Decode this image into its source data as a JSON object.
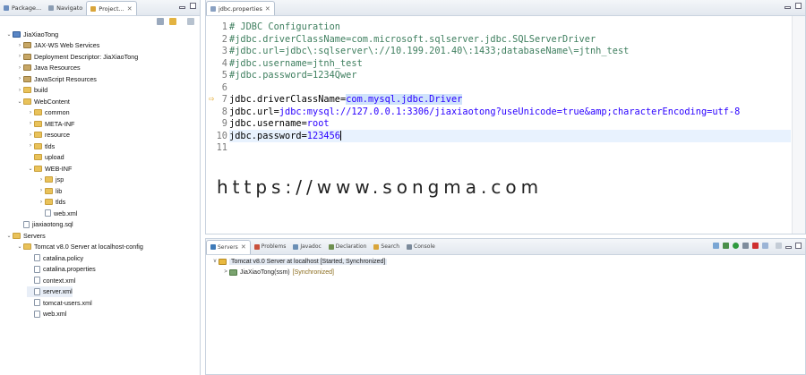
{
  "explorer": {
    "tabs": [
      {
        "label": "Package...",
        "active": false
      },
      {
        "label": "Navigato",
        "active": false
      },
      {
        "label": "Project...",
        "active": true
      }
    ],
    "tree": [
      {
        "label": "JiaXiaoTong",
        "depth": 0,
        "toggle": "v",
        "icon": "proj"
      },
      {
        "label": "JAX-WS Web Services",
        "depth": 1,
        "toggle": ">",
        "icon": "lib"
      },
      {
        "label": "Deployment Descriptor: JiaXiaoTong",
        "depth": 1,
        "toggle": ">",
        "icon": "lib"
      },
      {
        "label": "Java Resources",
        "depth": 1,
        "toggle": ">",
        "icon": "lib"
      },
      {
        "label": "JavaScript Resources",
        "depth": 1,
        "toggle": ">",
        "icon": "lib"
      },
      {
        "label": "build",
        "depth": 1,
        "toggle": ">",
        "icon": "folder"
      },
      {
        "label": "WebContent",
        "depth": 1,
        "toggle": "v",
        "icon": "folder"
      },
      {
        "label": "common",
        "depth": 2,
        "toggle": ">",
        "icon": "folder"
      },
      {
        "label": "META-INF",
        "depth": 2,
        "toggle": ">",
        "icon": "folder"
      },
      {
        "label": "resource",
        "depth": 2,
        "toggle": ">",
        "icon": "folder"
      },
      {
        "label": "tlds",
        "depth": 2,
        "toggle": ">",
        "icon": "folder"
      },
      {
        "label": "upload",
        "depth": 2,
        "toggle": "",
        "icon": "folder"
      },
      {
        "label": "WEB-INF",
        "depth": 2,
        "toggle": "v",
        "icon": "folder"
      },
      {
        "label": "jsp",
        "depth": 3,
        "toggle": ">",
        "icon": "folder"
      },
      {
        "label": "lib",
        "depth": 3,
        "toggle": ">",
        "icon": "folder"
      },
      {
        "label": "tlds",
        "depth": 3,
        "toggle": ">",
        "icon": "folder"
      },
      {
        "label": "web.xml",
        "depth": 3,
        "toggle": "",
        "icon": "file"
      },
      {
        "label": "jiaxiaotong.sql",
        "depth": 1,
        "toggle": "",
        "icon": "file"
      },
      {
        "label": "Servers",
        "depth": 0,
        "toggle": "v",
        "icon": "folder"
      },
      {
        "label": "Tomcat v8.0 Server at localhost-config",
        "depth": 1,
        "toggle": "v",
        "icon": "folder"
      },
      {
        "label": "catalina.policy",
        "depth": 2,
        "toggle": "",
        "icon": "file"
      },
      {
        "label": "catalina.properties",
        "depth": 2,
        "toggle": "",
        "icon": "file"
      },
      {
        "label": "context.xml",
        "depth": 2,
        "toggle": "",
        "icon": "file"
      },
      {
        "label": "server.xml",
        "depth": 2,
        "toggle": "",
        "icon": "file",
        "selected": true
      },
      {
        "label": "tomcat-users.xml",
        "depth": 2,
        "toggle": "",
        "icon": "file"
      },
      {
        "label": "web.xml",
        "depth": 2,
        "toggle": "",
        "icon": "file"
      }
    ]
  },
  "editor": {
    "tab": "jdbc.properties",
    "lines": [
      {
        "n": "1",
        "parts": [
          {
            "t": "# JDBC Configuration",
            "c": "cmt"
          }
        ]
      },
      {
        "n": "2",
        "parts": [
          {
            "t": "#jdbc.driverClassName=com.microsoft.sqlserver.jdbc.SQLServerDriver",
            "c": "cmt"
          }
        ]
      },
      {
        "n": "3",
        "parts": [
          {
            "t": "#jdbc.url=jdbc\\:sqlserver\\://10.199.201.40\\:1433;databaseName\\=jtnh_test",
            "c": "cmt"
          }
        ]
      },
      {
        "n": "4",
        "parts": [
          {
            "t": "#jdbc.username=jtnh_test",
            "c": "cmt"
          }
        ]
      },
      {
        "n": "5",
        "parts": [
          {
            "t": "#jdbc.password=1234Qwer",
            "c": "cmt"
          }
        ]
      },
      {
        "n": "6",
        "parts": []
      },
      {
        "n": "7",
        "parts": [
          {
            "t": "jdbc.driverClassName=",
            "c": "key"
          },
          {
            "t": "com.mysql.jdbc.Driver",
            "c": "val sel"
          }
        ]
      },
      {
        "n": "8",
        "parts": [
          {
            "t": "jdbc.url=",
            "c": "key"
          },
          {
            "t": "jdbc:mysql://127.0.0.1:3306/jiaxiaotong?useUnicode=true&amp;characterEncoding=utf-8",
            "c": "val"
          }
        ]
      },
      {
        "n": "9",
        "parts": [
          {
            "t": "jdbc.username=",
            "c": "key"
          },
          {
            "t": "root",
            "c": "val"
          }
        ]
      },
      {
        "n": "10",
        "parts": [
          {
            "t": "jdbc.password=",
            "c": "key"
          },
          {
            "t": "123456",
            "c": "val"
          }
        ],
        "cursor": true
      },
      {
        "n": "11",
        "parts": []
      }
    ]
  },
  "console": {
    "tabs": [
      {
        "label": "Servers",
        "active": true
      },
      {
        "label": "Problems",
        "active": false
      },
      {
        "label": "Javadoc",
        "active": false
      },
      {
        "label": "Declaration",
        "active": false
      },
      {
        "label": "Search",
        "active": false
      },
      {
        "label": "Console",
        "active": false
      }
    ],
    "server": {
      "name": "Tomcat v8.0 Server at localhost",
      "status": "[Started, Synchronized]"
    },
    "module": {
      "name": "JiaXiaoTong(ssm)",
      "status": "[Synchronized]"
    }
  },
  "watermark": "https://www.songma.com"
}
